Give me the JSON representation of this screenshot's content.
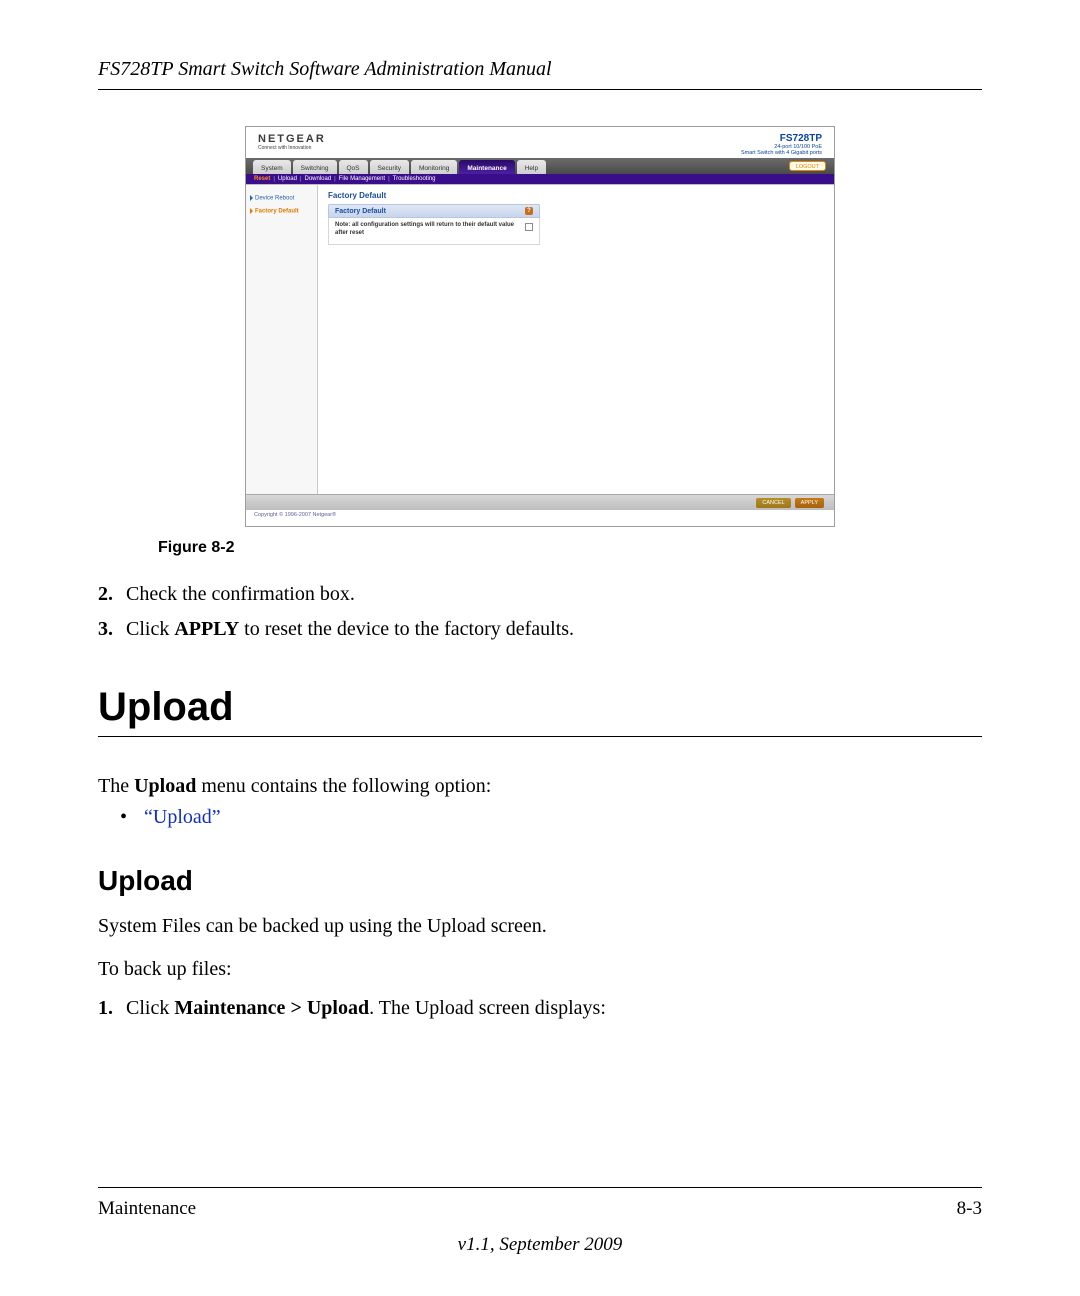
{
  "header": {
    "title": "FS728TP Smart Switch Software Administration Manual"
  },
  "screenshot": {
    "brand": "NETGEAR",
    "brand_tag": "Connect with Innovation",
    "product_model": "FS728TP",
    "product_desc_1": "24-port 10/100 PoE",
    "product_desc_2": "Smart Switch with 4 Gigabit ports",
    "tabs": [
      "System",
      "Switching",
      "QoS",
      "Security",
      "Monitoring",
      "Maintenance",
      "Help"
    ],
    "active_tab_index": 5,
    "logout": "LOGOUT",
    "subtabs": [
      "Reset",
      "Upload",
      "Download",
      "File Management",
      "Troubleshooting"
    ],
    "active_subtab_index": 0,
    "sidebar": {
      "items": [
        "Device Reboot",
        "Factory Default"
      ],
      "selected_index": 1
    },
    "panel_title": "Factory Default",
    "panel_header": "Factory Default",
    "panel_note": "Note: all configuration settings will return to their default value after reset",
    "cancel": "CANCEL",
    "apply": "APPLY",
    "copyright": "Copyright © 1996-2007 Netgear®"
  },
  "figure_caption": "Figure 8-2",
  "steps_a": {
    "n2": "2.",
    "t2": "Check the confirmation box.",
    "n3": "3.",
    "t3_pre": "Click ",
    "t3_b": "APPLY",
    "t3_post": " to reset the device to the factory defaults."
  },
  "section_heading": "Upload",
  "para1_pre": "The ",
  "para1_b": "Upload",
  "para1_post": " menu contains the following option:",
  "bullet_link": "“Upload”",
  "subsection_heading": "Upload",
  "para2": "System Files can be backed up using the Upload screen.",
  "para3": "To back up files:",
  "steps_b": {
    "n1": "1.",
    "t1_pre": "Click ",
    "t1_b": "Maintenance > Upload",
    "t1_post": ". The Upload screen displays:"
  },
  "footer": {
    "left": "Maintenance",
    "right": "8-3",
    "version": "v1.1, September 2009"
  }
}
